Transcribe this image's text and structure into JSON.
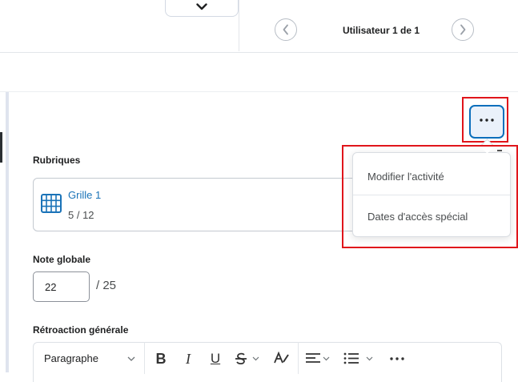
{
  "header": {
    "user_nav_text": "Utilisateur 1 de 1",
    "icons": [
      "chevron-down-icon",
      "chevron-left-icon",
      "chevron-right-icon"
    ]
  },
  "more_button": {
    "icon": "ellipsis-icon"
  },
  "context_menu": {
    "items": [
      {
        "label": "Modifier l'activité"
      },
      {
        "label": "Dates d'accès spécial"
      }
    ]
  },
  "rubrics": {
    "label": "Rubriques",
    "rubric_name": "Grille 1",
    "rubric_score": "5 / 12",
    "icon": "grid-icon"
  },
  "overall_grade": {
    "label": "Note globale",
    "value": "22",
    "max": "/ 25"
  },
  "feedback": {
    "label": "Rétroaction générale",
    "toolbar": {
      "paragraph_select": "Paragraphe",
      "bold": "B",
      "italic": "I",
      "underline": "U",
      "icons": [
        "strikethrough-icon",
        "text-color-icon",
        "align-icon",
        "list-icon",
        "more-icon"
      ]
    }
  },
  "colors": {
    "accent": "#0b6fbc",
    "highlight": "#e0151b",
    "link": "#1a73b8"
  }
}
